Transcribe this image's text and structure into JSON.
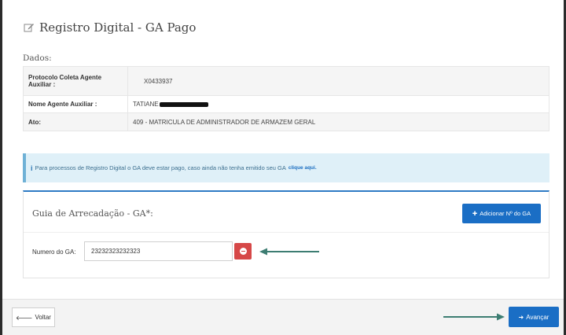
{
  "page": {
    "title": "Registro Digital - GA Pago"
  },
  "dados": {
    "label": "Dados:",
    "rows": [
      {
        "key": "Protocolo Coleta Agente Auxiliar :",
        "value": "X0433937"
      },
      {
        "key": "Nome Agente Auxiliar :",
        "value": "TATIANE"
      },
      {
        "key": "Ato:",
        "value": "409 - MATRICULA DE ADMINISTRADOR DE ARMAZEM GERAL"
      }
    ]
  },
  "info": {
    "icon": "i",
    "text": "Para processos de Registro Digital o GA deve estar pago, caso ainda não tenha emitido seu GA",
    "link_text": "clique aqui."
  },
  "ga": {
    "title": "Guia de Arrecadação - GA*:",
    "add_button_label": "Adicionar Nº do GA",
    "field_label": "Numero do GA:",
    "field_value": "23232323232323"
  },
  "footer": {
    "back_label": "Voltar",
    "next_label": "Avançar"
  },
  "colors": {
    "primary": "#1a6ec5",
    "danger": "#d64848",
    "info_bg": "#dff0f8",
    "annotation_arrow": "#3d7d72"
  },
  "icons": {
    "title": "edit-icon",
    "add": "plus-icon",
    "remove": "minus-circle-icon",
    "back": "arrow-left-icon",
    "next": "arrow-right-icon"
  }
}
